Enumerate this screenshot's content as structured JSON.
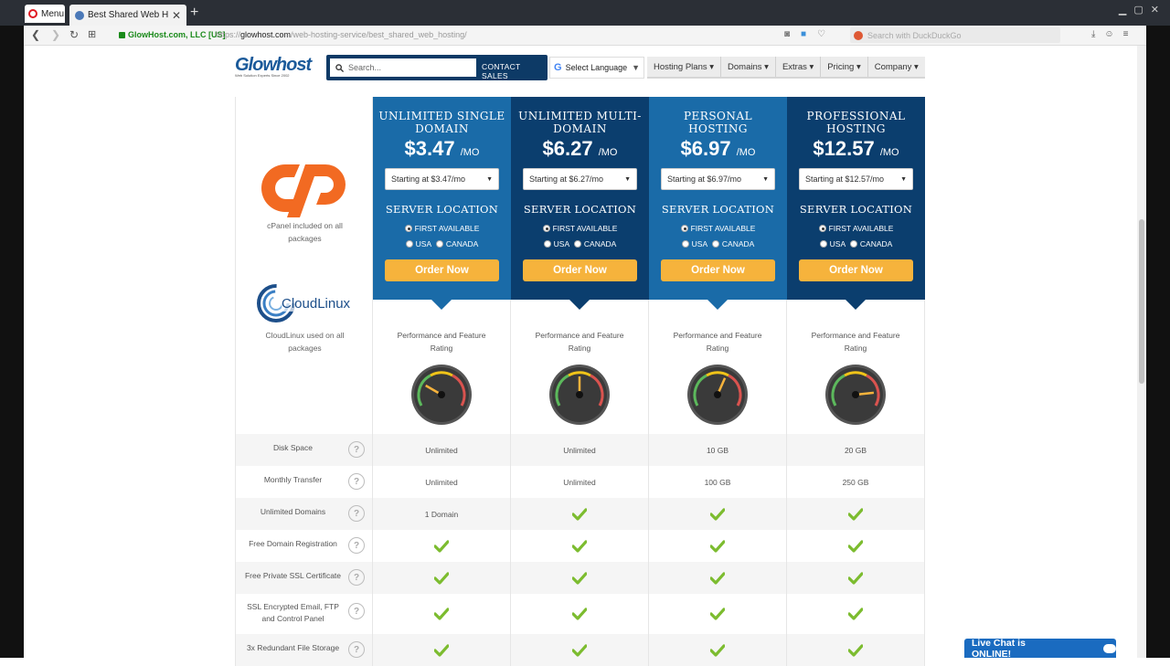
{
  "browser": {
    "menu_label": "Menu",
    "tab_title": "Best Shared Web Hosting S",
    "secure_label": "GlowHost.com, LLC [US]",
    "url_prefix": "https://",
    "url_host": "glowhost.com",
    "url_path": "/web-hosting-service/best_shared_web_hosting/",
    "search_placeholder": "Search with DuckDuckGo"
  },
  "site": {
    "logo": "Glowhost",
    "logo_tagline": "Web Solution Experts Since 2002",
    "search_placeholder": "Search...",
    "contact_label": "CONTACT SALES",
    "language_label": "Select Language",
    "nav": [
      "Hosting Plans ▾",
      "Domains ▾",
      "Extras ▾",
      "Pricing ▾",
      "Company ▾"
    ]
  },
  "side": {
    "cpanel_text_1": "cPanel included on all",
    "cpanel_text_2": "packages",
    "cloudlinux_logo": "CloudLinux",
    "cloudlinux_text_1": "CloudLinux used on all",
    "cloudlinux_text_2": "packages"
  },
  "plans": [
    {
      "name_1": "UNLIMITED SINGLE",
      "name_2": "DOMAIN",
      "price": "$3.47",
      "per": "/MO",
      "select": "Starting at $3.47/mo"
    },
    {
      "name_1": "UNLIMITED MULTI-",
      "name_2": "DOMAIN",
      "price": "$6.27",
      "per": "/MO",
      "select": "Starting at $6.27/mo"
    },
    {
      "name_1": "PERSONAL",
      "name_2": "HOSTING",
      "price": "$6.97",
      "per": "/MO",
      "select": "Starting at $6.97/mo"
    },
    {
      "name_1": "PROFESSIONAL",
      "name_2": "HOSTING",
      "price": "$12.57",
      "per": "/MO",
      "select": "Starting at $12.57/mo"
    }
  ],
  "plan_common": {
    "server_location": "SERVER LOCATION",
    "first_available": "FIRST AVAILABLE",
    "usa": "USA",
    "canada": "CANADA",
    "order": "Order Now",
    "rating_1": "Performance and Feature",
    "rating_2": "Rating"
  },
  "gauge_levels": [
    0.25,
    0.5,
    0.6,
    0.85
  ],
  "colors": {
    "plan_light": "#1a6ba8",
    "plan_dark": "#0b3e6e",
    "order": "#f6b33c",
    "check": "#7cbc2f",
    "cpanel": "#f26a22"
  },
  "features": [
    {
      "label_1": "Disk Space",
      "label_2": "",
      "values": [
        "Unlimited",
        "Unlimited",
        "10 GB",
        "20 GB"
      ]
    },
    {
      "label_1": "Monthly Transfer",
      "label_2": "",
      "values": [
        "Unlimited",
        "Unlimited",
        "100 GB",
        "250 GB"
      ]
    },
    {
      "label_1": "Unlimited Domains",
      "label_2": "",
      "values": [
        "1 Domain",
        "check",
        "check",
        "check"
      ]
    },
    {
      "label_1": "Free Domain Registration",
      "label_2": "",
      "values": [
        "check",
        "check",
        "check",
        "check"
      ]
    },
    {
      "label_1": "Free Private SSL Certificate",
      "label_2": "",
      "values": [
        "check",
        "check",
        "check",
        "check"
      ]
    },
    {
      "label_1": "SSL Encrypted Email, FTP",
      "label_2": "and Control Panel",
      "values": [
        "check",
        "check",
        "check",
        "check"
      ]
    },
    {
      "label_1": "3x Redundant File Storage",
      "label_2": "",
      "values": [
        "check",
        "check",
        "check",
        "check"
      ]
    }
  ],
  "help_glyph": "?",
  "livechat": "Live Chat is ONLINE!"
}
